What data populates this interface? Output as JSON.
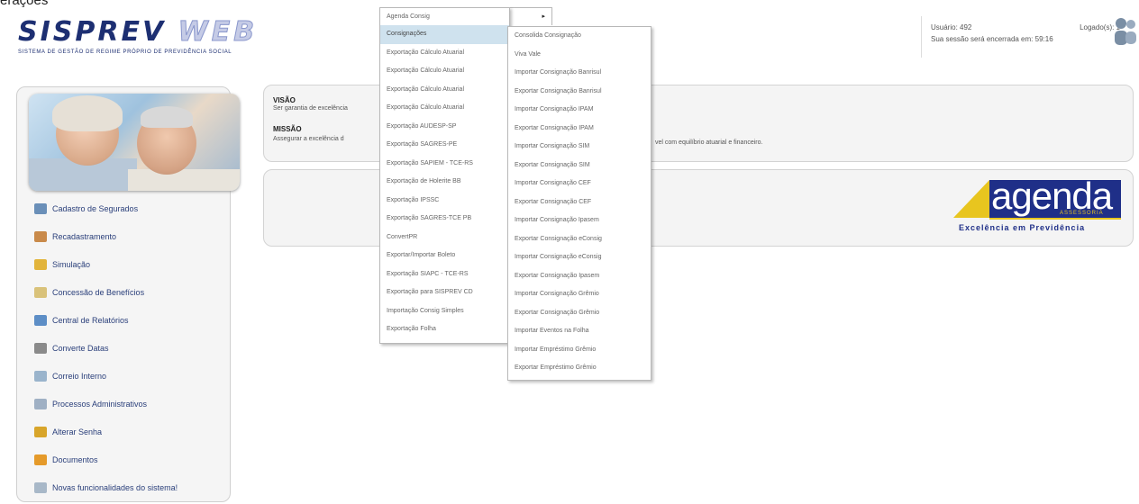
{
  "top_cut_text": "erações",
  "header": {
    "logo_title": "SISPREV",
    "logo_web": "WEB",
    "logo_subtitle": "SISTEMA DE GESTÃO DE REGIME PRÓPRIO DE PREVIDÊNCIA SOCIAL",
    "usuario": "Usuário: 492",
    "logados": "Logado(s): 1",
    "session_text": "Sua sessão será encerrada em: 59:16"
  },
  "sidebar": {
    "items": [
      {
        "label": "Cadastro de Segurados",
        "icon": "users-icon",
        "color": "#6a8fb8"
      },
      {
        "label": "Recadastramento",
        "icon": "user-icon",
        "color": "#c98a4a"
      },
      {
        "label": "Simulação",
        "icon": "folder-icon",
        "color": "#e2b43b"
      },
      {
        "label": "Concessão de Benefícios",
        "icon": "document-icon",
        "color": "#d9c27a"
      },
      {
        "label": "Central de Relatórios",
        "icon": "report-icon",
        "color": "#5d8ec6"
      },
      {
        "label": "Converte Datas",
        "icon": "calendar-icon",
        "color": "#8a8a8a"
      },
      {
        "label": "Correio Interno",
        "icon": "mail-icon",
        "color": "#9ab4cc"
      },
      {
        "label": "Processos Administrativos",
        "icon": "process-icon",
        "color": "#9fb0c4"
      },
      {
        "label": "Alterar Senha",
        "icon": "key-icon",
        "color": "#d8a52a"
      },
      {
        "label": "Documentos",
        "icon": "documents-icon",
        "color": "#e59a2a"
      },
      {
        "label": "Novas funcionalidades do sistema!",
        "icon": "new-features-icon",
        "color": "#a8b8c8"
      }
    ]
  },
  "panel1": {
    "visao_title": "VISÃO",
    "visao_text": "Ser garantia de excelência",
    "missao_title": "MISSÃO",
    "missao_text": "Assegurar a excelência d",
    "missao_text_end": "vel com equilíbrio atuarial e financeiro."
  },
  "agenda": {
    "word": "agenda",
    "sub": "ASSESSORIA",
    "tagline": "Excelência em Previdência"
  },
  "menu1": {
    "items": [
      "Agenda Consig",
      "Consignações",
      "Exportação Cálculo Atuarial",
      "Exportação Cálculo Atuarial",
      "Exportação Cálculo Atuarial",
      "Exportação Cálculo Atuarial",
      "Exportação AUDESP-SP",
      "Exportação SAGRES-PE",
      "Exportação SAPIEM - TCE-RS",
      "Exportação de Holerite BB",
      "Exportação IPSSC",
      "Exportação SAGRES-TCE PB",
      "ConvertPR",
      "Exportar/Importar Boleto",
      "Exportação SIAPC - TCE-RS",
      "Exportação para SISPREV CD",
      "Importação Consig Simples",
      "Exportação Folha"
    ],
    "arrow": "▸"
  },
  "menu2": {
    "items": [
      "Consolida Consignação",
      "Viva Vale",
      "Importar Consignação Banrisul",
      "Exportar Consignação Banrisul",
      "Importar Consignação IPAM",
      "Exportar Consignação IPAM",
      "Importar Consignação SIM",
      "Exportar Consignação SIM",
      "Importar Consignação CEF",
      "Exportar Consignação CEF",
      "Importar Consignação Ipasem",
      "Exportar Consignação eConsig",
      "Importar Consignação eConsig",
      "Exportar Consignação Ipasem",
      "Importar Consignação Grêmio",
      "Exportar Consignação Grêmio",
      "Importar Eventos na Folha",
      "Importar Empréstimo Grêmio",
      "Exportar Empréstimo Grêmio"
    ]
  }
}
